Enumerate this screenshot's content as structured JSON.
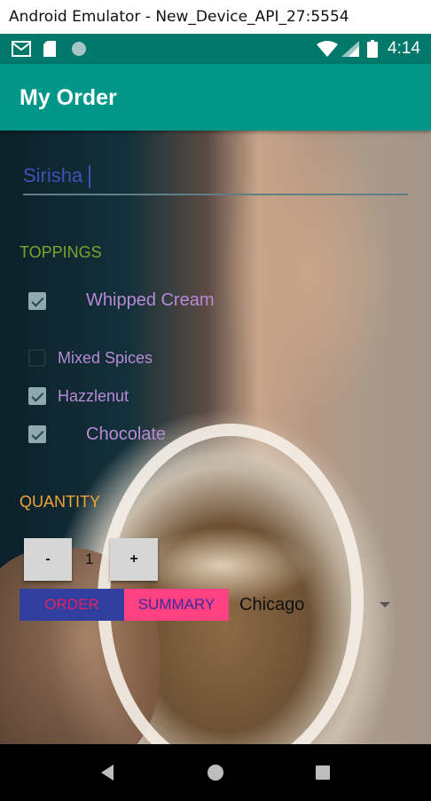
{
  "window": {
    "title": "Android Emulator - New_Device_API_27:5554"
  },
  "status_bar": {
    "time": "4:14",
    "icons": [
      "gmail-icon",
      "sd-card-icon",
      "sync-icon",
      "wifi-icon",
      "signal-icon",
      "battery-icon"
    ]
  },
  "app_bar": {
    "title": "My Order"
  },
  "form": {
    "name_value": "Sirisha",
    "toppings_label": "TOPPINGS",
    "toppings": [
      {
        "label": "Whipped Cream",
        "checked": true
      },
      {
        "label": "Mixed Spices",
        "checked": false
      },
      {
        "label": "Hazzlenut",
        "checked": true
      },
      {
        "label": "Chocolate",
        "checked": true
      }
    ],
    "quantity_label": "QUANTITY",
    "decrement_label": "-",
    "increment_label": "+",
    "quantity": "1",
    "order_label": "ORDER",
    "summary_label": "SUMMARY",
    "city_selected": "Chicago"
  },
  "colors": {
    "status_bar": "#00796b",
    "app_bar": "#009688",
    "toppings_label": "#7fa32c",
    "quantity_label": "#f2a43a",
    "checkbox_label": "#b98ad6",
    "order_button_bg": "#303f9f",
    "summary_button_bg": "#ff4081"
  },
  "nav_bar": {
    "icons": [
      "back-icon",
      "home-icon",
      "recents-icon"
    ]
  }
}
